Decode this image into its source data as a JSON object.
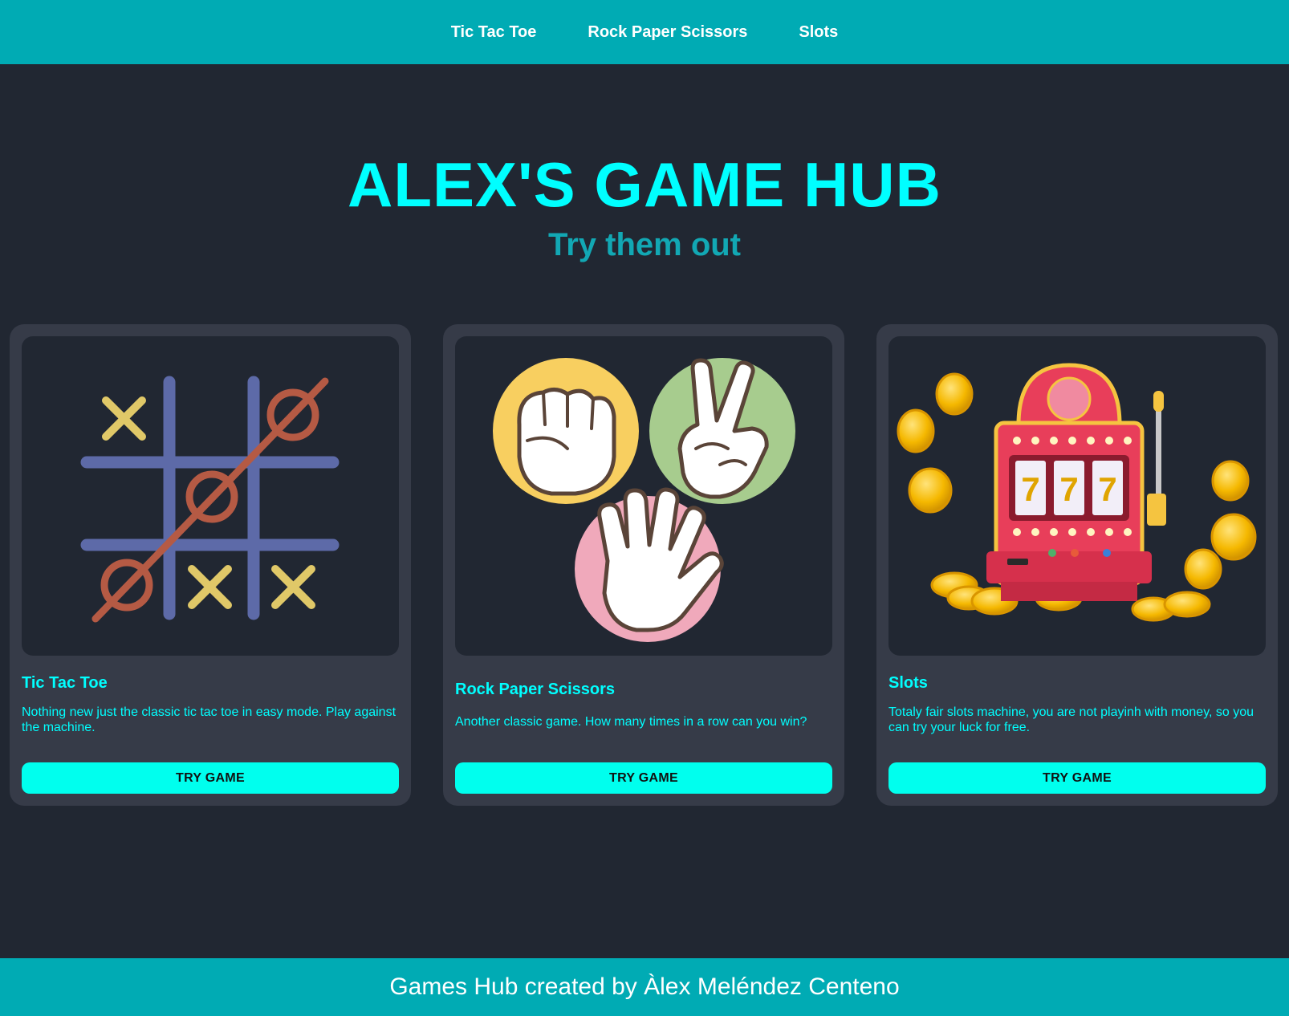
{
  "nav": {
    "items": [
      "Tic Tac Toe",
      "Rock Paper Scissors",
      "Slots"
    ]
  },
  "hero": {
    "title": "ALEX'S GAME HUB",
    "subtitle": "Try them out"
  },
  "cards": [
    {
      "title": "Tic Tac Toe",
      "description": "Nothing new just the classic tic tac toe in easy mode. Play against the machine.",
      "button": "TRY GAME",
      "image_icon": "tic-tac-toe-board-icon"
    },
    {
      "title": "Rock Paper Scissors",
      "description": "Another classic game. How many times in a row can you win?",
      "button": "TRY GAME",
      "image_icon": "rock-paper-scissors-hands-icon"
    },
    {
      "title": "Slots",
      "description": "Totaly fair slots machine, you are not playinh with money, so you can try your luck for free.",
      "button": "TRY GAME",
      "image_icon": "slot-machine-icon"
    }
  ],
  "slot_reels": [
    "7",
    "7",
    "7"
  ],
  "footer": {
    "text": "Games Hub created by Àlex Meléndez Centeno"
  },
  "colors": {
    "header_bg": "#00abb4",
    "page_bg": "#212732",
    "card_bg": "#363b48",
    "accent": "#00ffff",
    "button_bg": "#00ffee"
  }
}
